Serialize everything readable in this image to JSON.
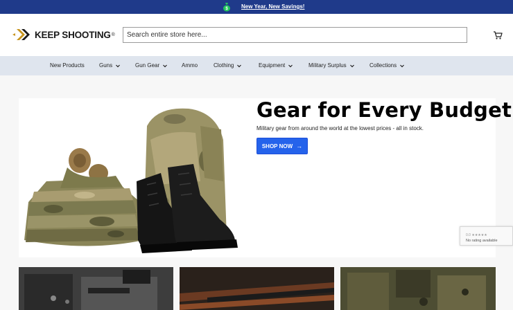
{
  "promo": {
    "text": "New Year, New Savings!",
    "icon": "money-bag-icon"
  },
  "header": {
    "logo_text": "KEEP SHOOTING",
    "logo_mark": "®",
    "search_placeholder": "Search entire store here...",
    "cart_icon": "cart-icon"
  },
  "nav": {
    "items": [
      {
        "label": "New Products",
        "dropdown": false
      },
      {
        "label": "Guns",
        "dropdown": true
      },
      {
        "label": "Gun Gear",
        "dropdown": true
      },
      {
        "label": "Ammo",
        "dropdown": false
      },
      {
        "label": "Clothing",
        "dropdown": true
      },
      {
        "label": "Equipment",
        "dropdown": true
      },
      {
        "label": "Military Surplus",
        "dropdown": true
      },
      {
        "label": "Collections",
        "dropdown": true
      }
    ]
  },
  "hero": {
    "title": "Gear for Every Budget",
    "subtitle": "Military gear from around the world at the lowest prices - all in stock.",
    "button_label": "SHOP NOW"
  },
  "badge": {
    "stars": "0.0 ★★★★★",
    "text": "No rating available"
  },
  "colors": {
    "promo_bg": "#1f3a8a",
    "nav_bg": "#dfe5ee",
    "button": "#2563eb",
    "logo_accent": "#c8951f"
  }
}
